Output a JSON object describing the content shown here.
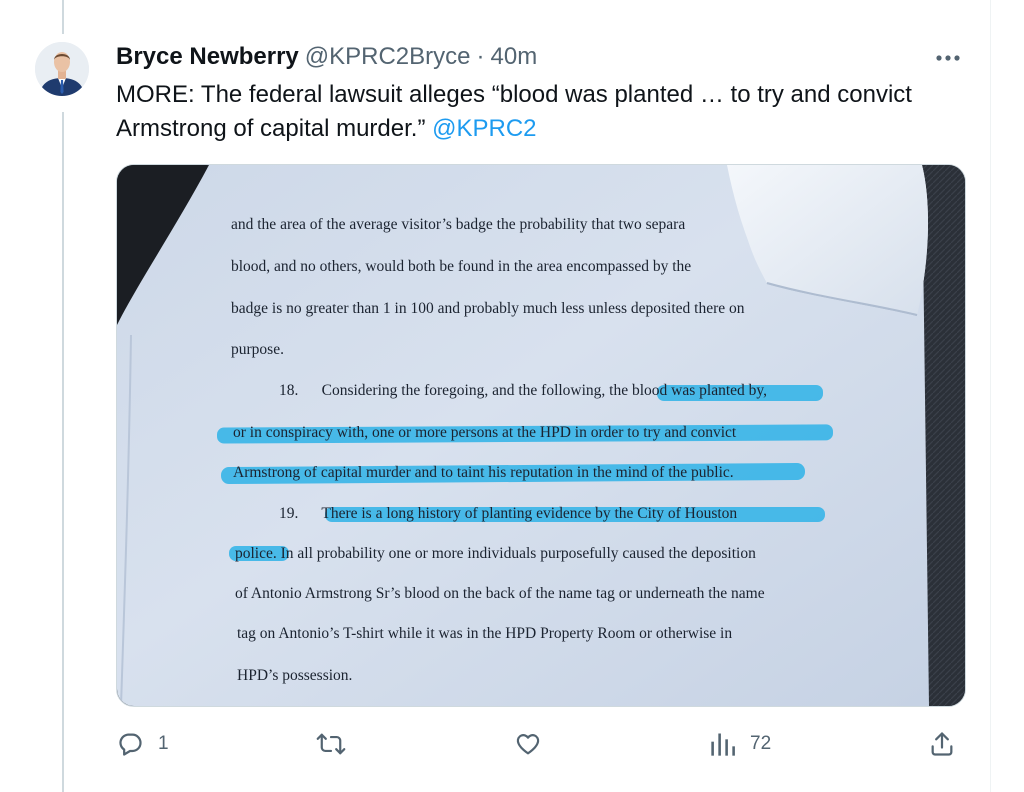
{
  "tweet": {
    "author_name": "Bryce Newberry",
    "handle": "@KPRC2Bryce",
    "separator": "·",
    "time": "40m",
    "text": "MORE: The federal lawsuit alleges “blood was planted … to try and convict Armstrong of capital murder.”",
    "mention": "@KPRC2"
  },
  "document": {
    "lines": [
      "and the area of the average visitor’s badge the probability that two separa",
      "blood, and no others, would both be found in the area encompassed by the",
      "badge is no greater than 1 in 100 and probably much less unless deposited there on",
      "purpose.",
      "18.      Considering the foregoing, and the following, the blood was planted by,",
      "or in conspiracy with, one or more persons at the HPD in order to try and convict",
      "Armstrong of capital murder and to taint his reputation in the mind of the public.",
      "19.      There is a long history of planting evidence by the City of Houston",
      "police. In all probability one or more individuals purposefully caused the deposition",
      "of Antonio Armstrong Sr’s blood on the back of the name tag or underneath the name",
      "tag on Antonio’s T-shirt while it was in the HPD Property Room or otherwise in",
      "HPD’s possession."
    ]
  },
  "actions": {
    "reply_count": "1",
    "retweet_count": "",
    "like_count": "",
    "views_count": "72"
  },
  "icons": {
    "reply": "reply-icon",
    "retweet": "retweet-icon",
    "like": "heart-icon",
    "views": "views-icon",
    "share": "share-icon",
    "more": "more-icon"
  },
  "colors": {
    "link": "#1d9bf0",
    "highlight": "#2fb3e8",
    "text": "#0f1419",
    "secondary": "#536471"
  }
}
